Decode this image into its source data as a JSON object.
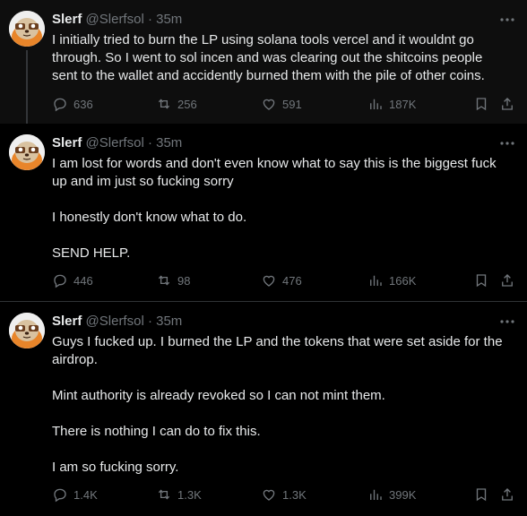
{
  "tweets": [
    {
      "name": "Slerf",
      "handle": "@Slerfsol",
      "time": "35m",
      "lines": [
        "I initially tried to burn the LP using solana tools vercel and it wouldnt go",
        "through. So I went to sol incen and was clearing out the shitcoins people",
        "sent to the wallet and accidently burned them with the pile of other coins."
      ],
      "stats": {
        "replies": "636",
        "reposts": "256",
        "likes": "591",
        "views": "187K"
      }
    },
    {
      "name": "Slerf",
      "handle": "@Slerfsol",
      "time": "35m",
      "lines": [
        "I am lost for words and don't even know what to say this is the biggest fuck",
        "up and im just so fucking sorry",
        "",
        "I honestly don't know what to do.",
        "",
        "SEND HELP."
      ],
      "stats": {
        "replies": "446",
        "reposts": "98",
        "likes": "476",
        "views": "166K"
      }
    },
    {
      "name": "Slerf",
      "handle": "@Slerfsol",
      "time": "35m",
      "lines": [
        "Guys I fucked up. I burned the LP and the tokens that were set aside for the",
        "airdrop.",
        "",
        "Mint authority is already revoked so I can not mint them.",
        "",
        "There is nothing I can do to fix this.",
        "",
        "I am so fucking sorry."
      ],
      "stats": {
        "replies": "1.4K",
        "reposts": "1.3K",
        "likes": "1.3K",
        "views": "399K"
      }
    }
  ],
  "separator": "·",
  "icons": [
    "more-icon",
    "reply-icon",
    "repost-icon",
    "like-icon",
    "views-icon",
    "bookmark-icon",
    "share-icon"
  ],
  "colors": {
    "background": "#000000",
    "text": "#e7e9ea",
    "secondary": "#71767b",
    "divider": "#2f3336"
  }
}
